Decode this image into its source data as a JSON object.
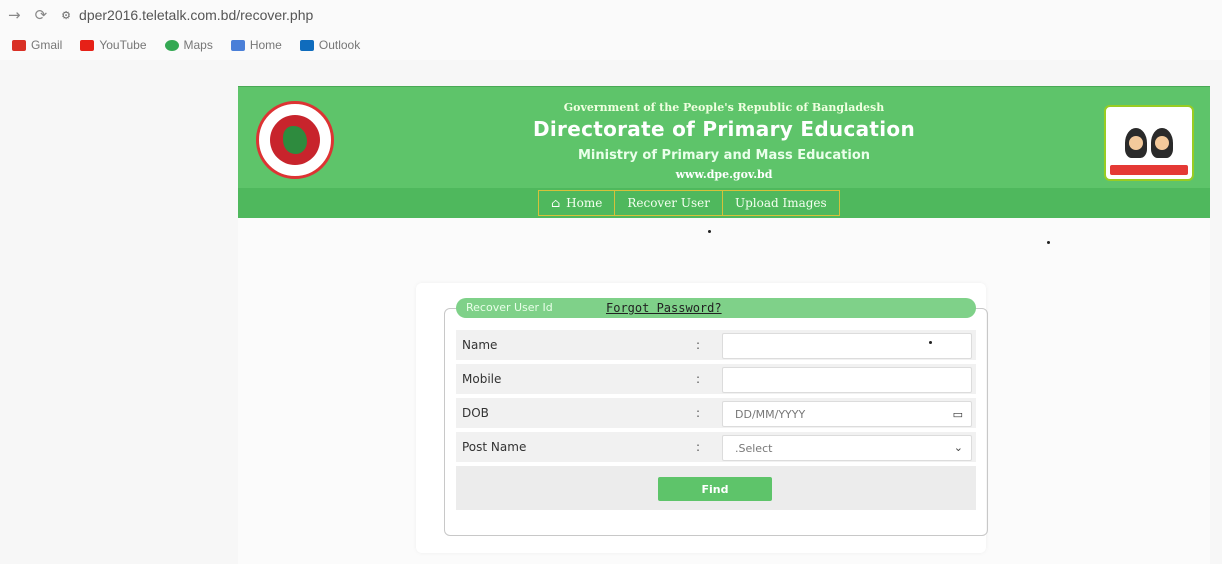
{
  "browser": {
    "url": "dper2016.teletalk.com.bd/recover.php",
    "bookmarks": [
      {
        "label": "Gmail",
        "color": "#d93025"
      },
      {
        "label": "YouTube",
        "color": "#e62117"
      },
      {
        "label": "Maps",
        "color": "#34a853"
      },
      {
        "label": "Home",
        "color": "#4a7fd8"
      },
      {
        "label": "Outlook",
        "color": "#0f6cbd"
      }
    ]
  },
  "header": {
    "gov": "Government of the People's Republic of Bangladesh",
    "title": "Directorate of Primary Education",
    "ministry": "Ministry of Primary and Mass Education",
    "website": "www.dpe.gov.bd"
  },
  "nav": {
    "home": "Home",
    "recover": "Recover User",
    "upload": "Upload Images"
  },
  "form": {
    "tabs": {
      "recover": "Recover User Id",
      "forgot": "Forgot Password?"
    },
    "colon": ":",
    "fields": {
      "name": {
        "label": "Name",
        "value": ""
      },
      "mobile": {
        "label": "Mobile",
        "value": ""
      },
      "dob": {
        "label": "DOB",
        "placeholder": "DD/MM/YYYY"
      },
      "post": {
        "label": "Post Name",
        "selected": ".Select"
      }
    },
    "find_label": "Find"
  },
  "colors": {
    "green": "#5ec46a",
    "green_dark": "#4fb85d",
    "nav_border": "#d6c13a"
  }
}
